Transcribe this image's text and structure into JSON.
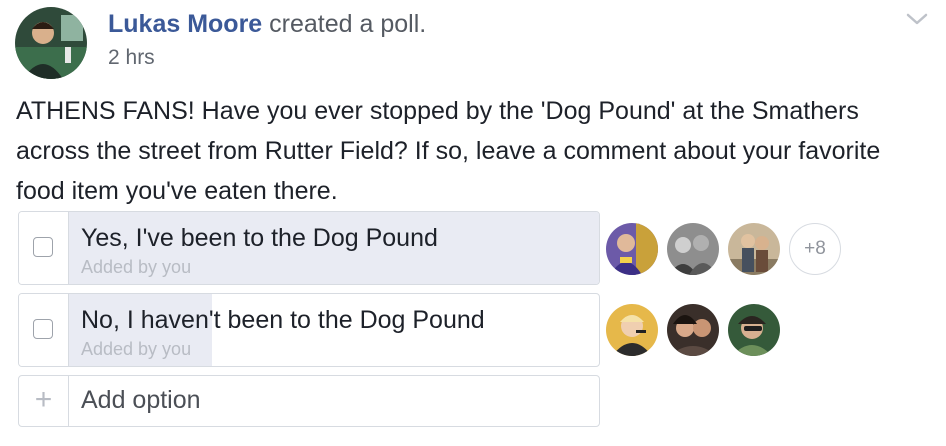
{
  "post": {
    "author_name": "Lukas Moore",
    "action_text": "created a poll.",
    "timestamp": "2 hrs",
    "body": "ATHENS FANS! Have you ever stopped by the 'Dog Pound' at the Smathers across the street from Rutter Field? If so, leave a comment about your favorite food item you've eaten there.",
    "menu_icon": "chevron-down-icon",
    "avatar_icon": "author-avatar"
  },
  "poll": {
    "options": [
      {
        "label": "Yes, I've been to the Dog Pound",
        "added_by": "Added by you",
        "vote_share": 1.0,
        "checked": false,
        "more_voters": "+8"
      },
      {
        "label": "No, I haven't been to the Dog Pound",
        "added_by": "Added by you",
        "vote_share": 0.27,
        "checked": false
      }
    ],
    "add_option_placeholder": "Add option",
    "add_icon": "plus-icon"
  },
  "colors": {
    "author_link": "#3b5998",
    "poll_fill": "#e9ebf3",
    "border": "#d7dbe1"
  }
}
